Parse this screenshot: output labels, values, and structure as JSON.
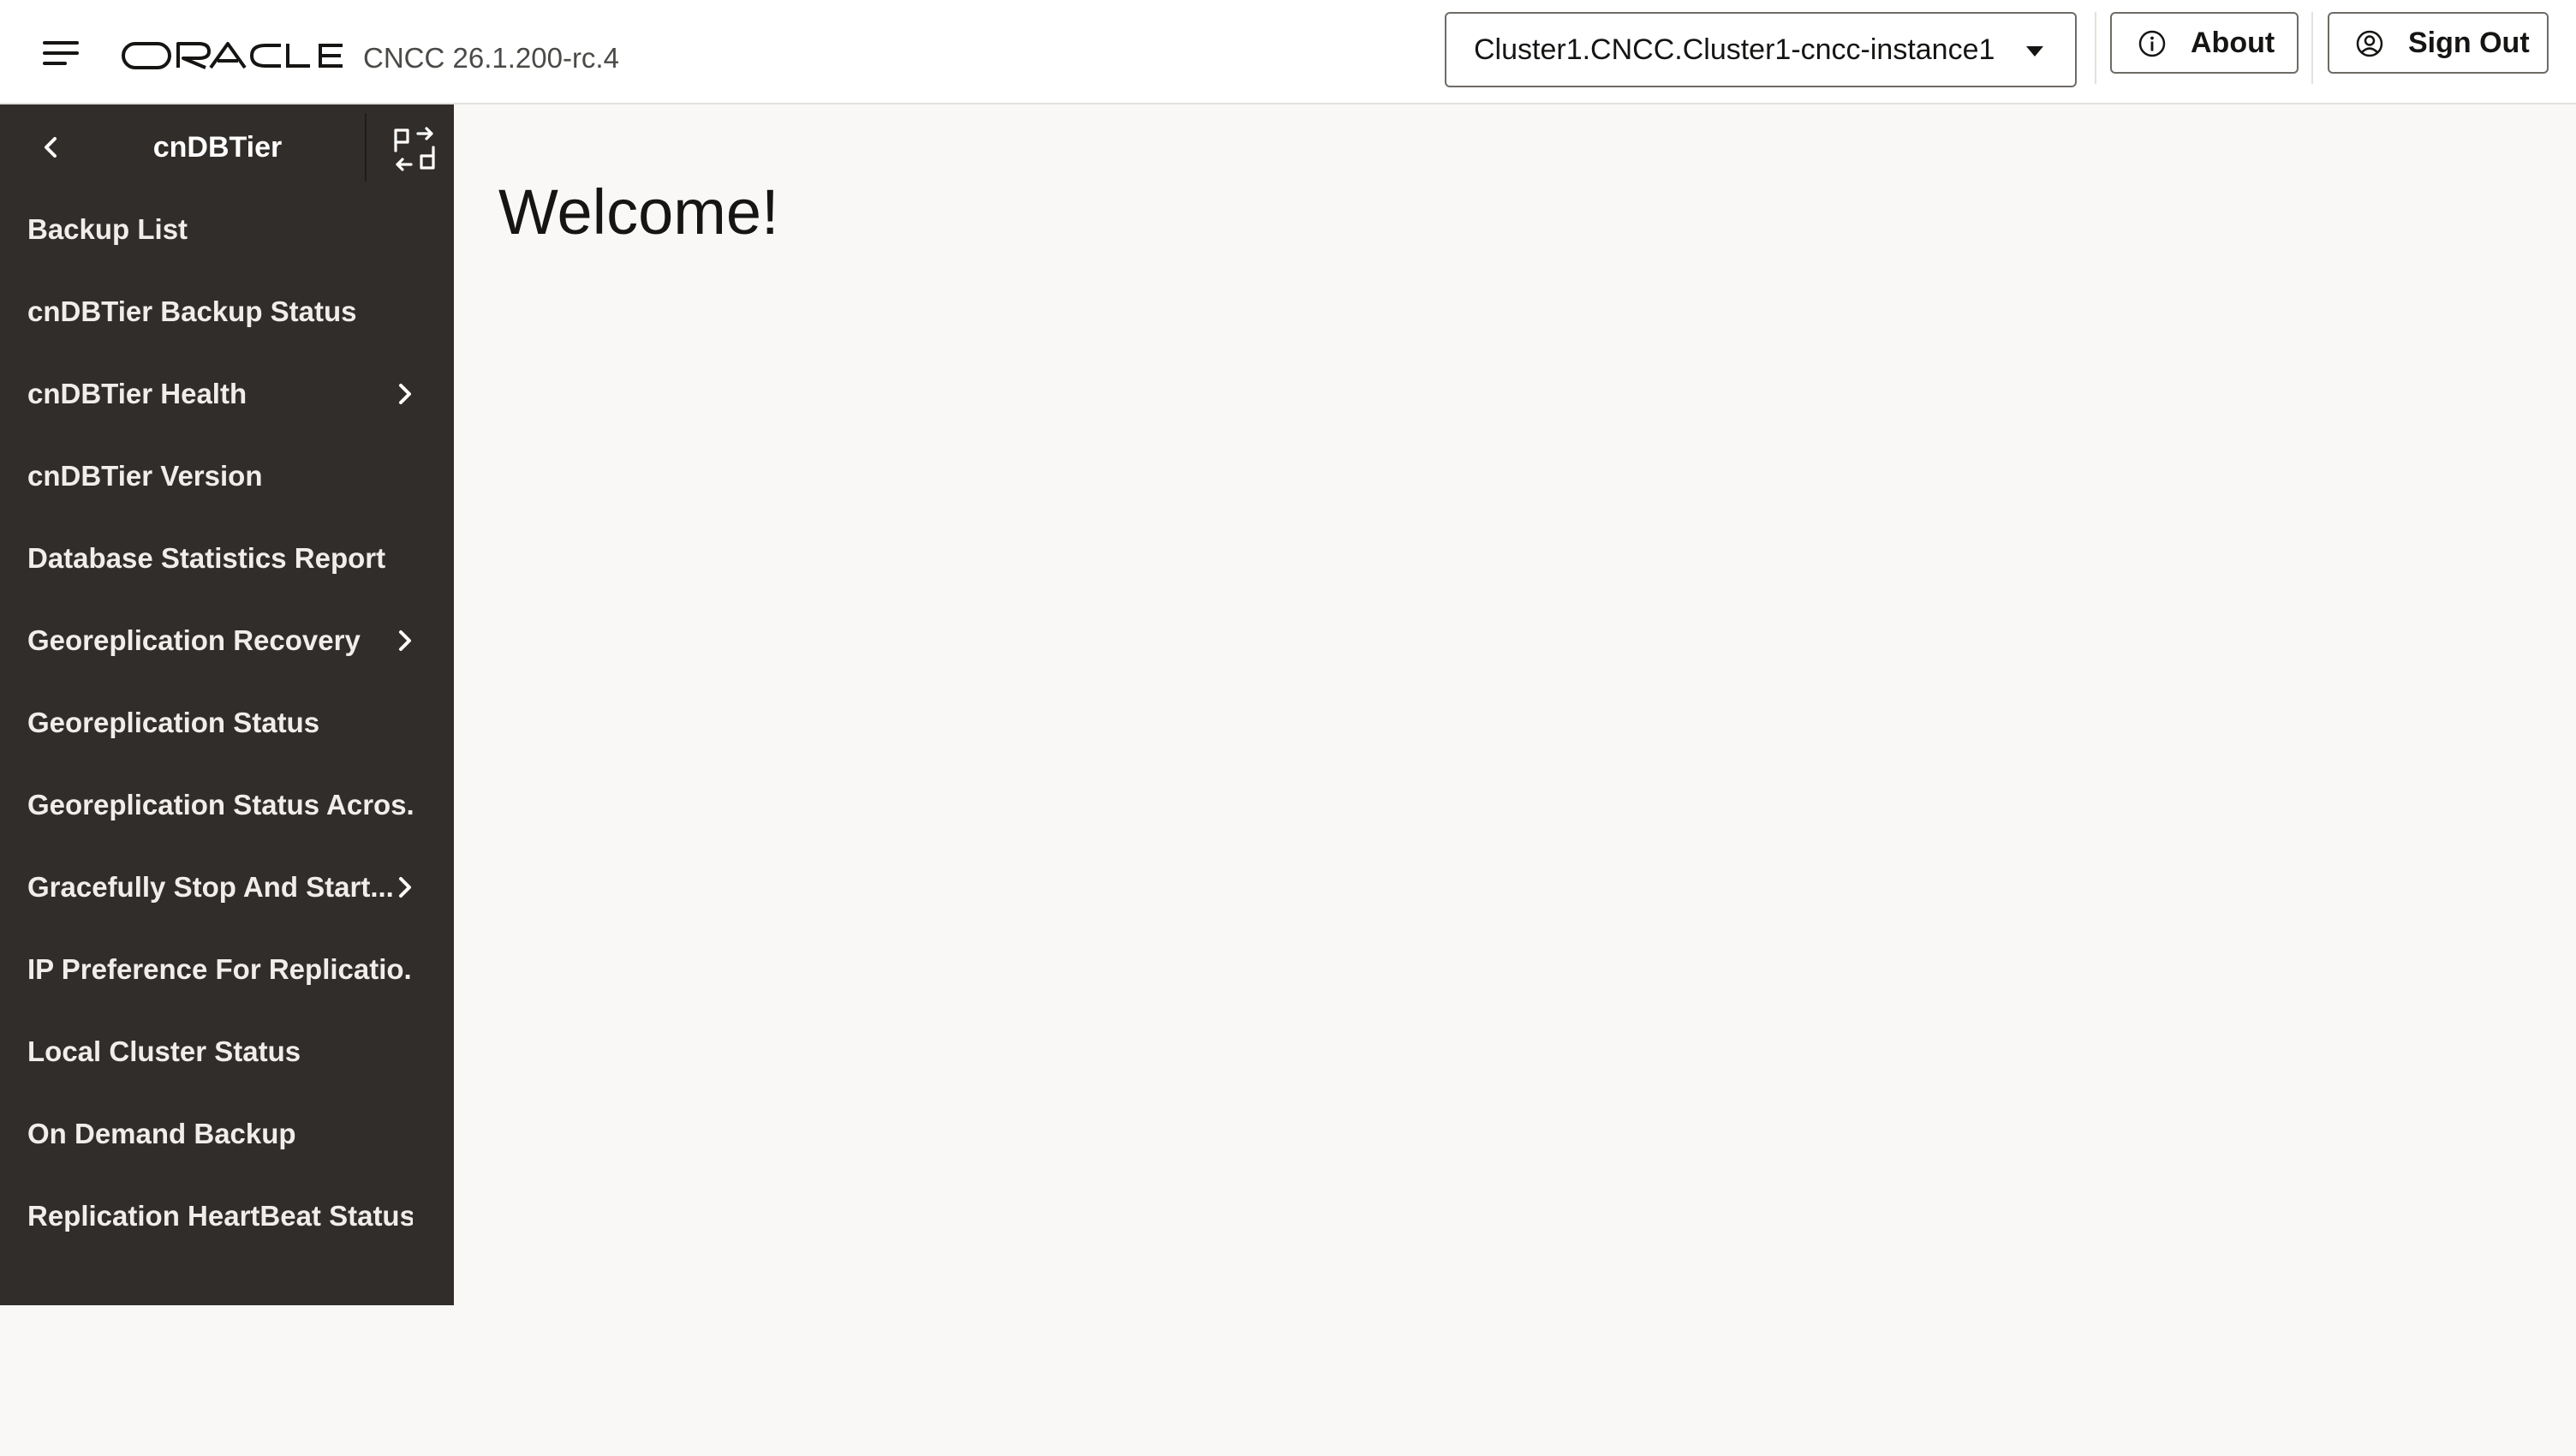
{
  "header": {
    "menu_icon": "hamburger-menu-icon",
    "logo_text": "ORACLE",
    "version": "CNCC 26.1.200-rc.4",
    "cluster_select": {
      "value": "Cluster1.CNCC.Cluster1-cncc-instance1",
      "icon": "caret-down-icon"
    },
    "about_button": {
      "label": "About",
      "icon": "info-icon"
    },
    "signout_button": {
      "label": "Sign Out",
      "icon": "user-circle-icon"
    }
  },
  "sidebar": {
    "title": "cnDBTier",
    "back_icon": "chevron-left-icon",
    "expand_icon": "expand-collapse-icon",
    "items": [
      {
        "label": "Backup List",
        "has_children": false
      },
      {
        "label": "cnDBTier Backup Status",
        "has_children": false
      },
      {
        "label": "cnDBTier Health",
        "has_children": true
      },
      {
        "label": "cnDBTier Version",
        "has_children": false
      },
      {
        "label": "Database Statistics Report",
        "has_children": false
      },
      {
        "label": "Georeplication Recovery",
        "has_children": true
      },
      {
        "label": "Georeplication Status",
        "has_children": false
      },
      {
        "label": "Georeplication Status Acros...",
        "has_children": false
      },
      {
        "label": "Gracefully Stop And Start...",
        "has_children": true
      },
      {
        "label": "IP Preference For Replicatio...",
        "has_children": false
      },
      {
        "label": "Local Cluster Status",
        "has_children": false
      },
      {
        "label": "On Demand Backup",
        "has_children": false
      },
      {
        "label": "Replication HeartBeat Status",
        "has_children": false
      }
    ]
  },
  "main": {
    "title": "Welcome!"
  },
  "colors": {
    "sidebar_bg": "#312d2a",
    "page_bg": "#f9f8f6",
    "header_bg": "#ffffff",
    "text": "#161513"
  }
}
